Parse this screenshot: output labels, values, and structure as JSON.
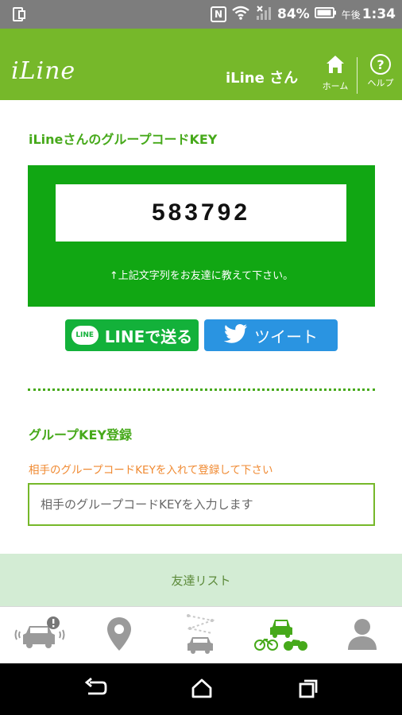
{
  "status_bar": {
    "nfc": "N",
    "battery_percent": "84%",
    "time_period": "午後",
    "time": "1:34"
  },
  "header": {
    "logo": "iLine",
    "user_name": "iLine さん",
    "home_label": "ホーム",
    "help_label": "ヘルプ",
    "help_glyph": "?"
  },
  "group_code": {
    "title": "iLineさんのグループコードKEY",
    "code": "583792",
    "note": "↑上記文字列をお友達に教えて下さい。"
  },
  "share": {
    "line_badge": "LINE",
    "line_label": "LINEで送る",
    "tweet_label": "ツイート"
  },
  "register": {
    "title": "グループKEY登録",
    "hint": "相手のグループコードKEYを入れて登録して下さい",
    "placeholder": "相手のグループコードKEYを入力します"
  },
  "friends": {
    "label": "友達リスト"
  },
  "tabs": [
    {
      "icon": "car-alert-icon"
    },
    {
      "icon": "map-pin-icon"
    },
    {
      "icon": "route-car-icon"
    },
    {
      "icon": "vehicles-icon",
      "active": true
    },
    {
      "icon": "profile-icon"
    }
  ],
  "colors": {
    "brand_green": "#76b82a",
    "code_panel": "#11a713",
    "line_green": "#13b13a",
    "twitter_blue": "#2a94e1",
    "hint_orange": "#f08a32",
    "friends_bg": "#d3ecd4"
  }
}
